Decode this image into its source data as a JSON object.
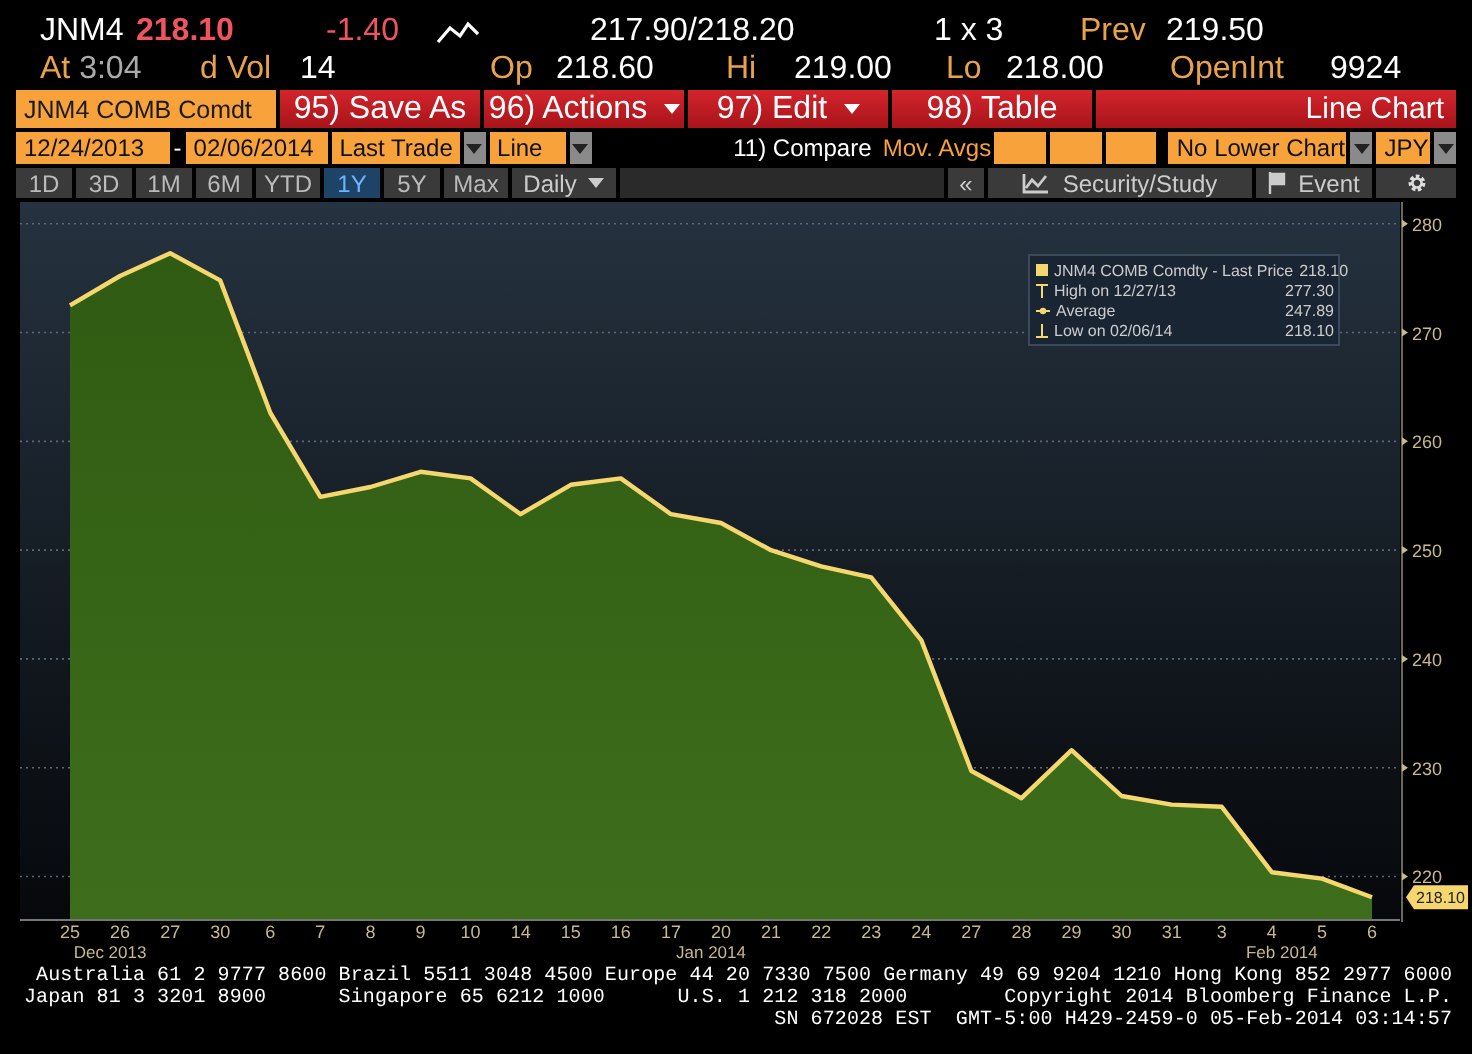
{
  "quote": {
    "symbol": "JNM4",
    "last": "218.10",
    "change": "-1.40",
    "bid_ask": "217.90/218.20",
    "size": "1 x 3",
    "prev_label": "Prev",
    "prev": "219.50",
    "time_label": "At",
    "time": "3:04",
    "vol_label": "d Vol",
    "vol": "14",
    "stats": [
      {
        "label": "Op",
        "value": "218.60"
      },
      {
        "label": "Hi",
        "value": "219.00"
      },
      {
        "label": "Lo",
        "value": "218.00"
      },
      {
        "label": "OpenInt",
        "value": "9924"
      }
    ]
  },
  "toolbar": {
    "security": "JNM4 COMB Comdt",
    "buttons": [
      {
        "label": "95) Save As",
        "kind": "plain"
      },
      {
        "label": "96) Actions",
        "kind": "dropdown"
      },
      {
        "label": "97) Edit",
        "kind": "dropdown"
      },
      {
        "label": "98) Table",
        "kind": "plain"
      }
    ],
    "title": "Line Chart",
    "start_date": "12/24/2013",
    "date_separator": "-",
    "end_date": "02/06/2014",
    "price_field": "Last Trade",
    "chart_style": "Line",
    "compare": "11) Compare",
    "mov_avgs_label": "Mov. Avgs",
    "lower_chart": "No Lower Chart",
    "currency": "JPY",
    "periods": [
      {
        "label": "1D",
        "selected": false
      },
      {
        "label": "3D",
        "selected": false
      },
      {
        "label": "1M",
        "selected": false
      },
      {
        "label": "6M",
        "selected": false
      },
      {
        "label": "YTD",
        "selected": false
      },
      {
        "label": "1Y",
        "selected": true
      },
      {
        "label": "5Y",
        "selected": false
      },
      {
        "label": "Max",
        "selected": false
      }
    ],
    "frequency": "Daily",
    "collapse": "«",
    "security_study": "Security/Study",
    "event": "Event"
  },
  "chart": {
    "legend": [
      {
        "kind": "series",
        "label": "JNM4 COMB Comdty - Last Price",
        "value": "218.10"
      },
      {
        "kind": "high",
        "label": "High on 12/27/13",
        "value": "277.30"
      },
      {
        "kind": "average",
        "label": "Average",
        "value": "247.89"
      },
      {
        "kind": "low",
        "label": "Low on 02/06/14",
        "value": "218.10"
      }
    ],
    "price_tag": "218.10",
    "chart_data": {
      "type": "area",
      "categories": [
        "25",
        "26",
        "27",
        "30",
        "6",
        "7",
        "8",
        "9",
        "10",
        "14",
        "15",
        "16",
        "17",
        "20",
        "21",
        "22",
        "23",
        "24",
        "27",
        "28",
        "29",
        "30",
        "31",
        "3",
        "4",
        "5",
        "6"
      ],
      "series": [
        {
          "color": "#f5d76e",
          "values": [
            272.5,
            275.2,
            277.3,
            274.8,
            262.6,
            254.9,
            255.8,
            257.2,
            256.6,
            253.3,
            256.0,
            256.6,
            253.3,
            252.5,
            250.0,
            248.5,
            247.5,
            241.7,
            229.7,
            227.2,
            231.6,
            227.4,
            226.6,
            226.4,
            220.4,
            219.8,
            218.1
          ]
        }
      ],
      "ylim": [
        216,
        282
      ],
      "yticks": [
        220,
        230,
        240,
        250,
        260,
        270,
        280
      ],
      "grid": true
    },
    "month_labels": [
      "Dec 2013",
      "Jan 2014",
      "Feb 2014"
    ]
  },
  "footer": [
    "Australia 61 2 9777 8600 Brazil 5511 3048 4500 Europe 44 20 7330 7500 Germany 49 69 9204 1210 Hong Kong 852 2977 6000",
    "Japan 81 3 3201 8900      Singapore 65 6212 1000      U.S. 1 212 318 2000        Copyright 2014 Bloomberg Finance L.P.",
    "SN 672028 EST  GMT-5:00 H429-2459-0 05-Feb-2014 03:14:57"
  ]
}
